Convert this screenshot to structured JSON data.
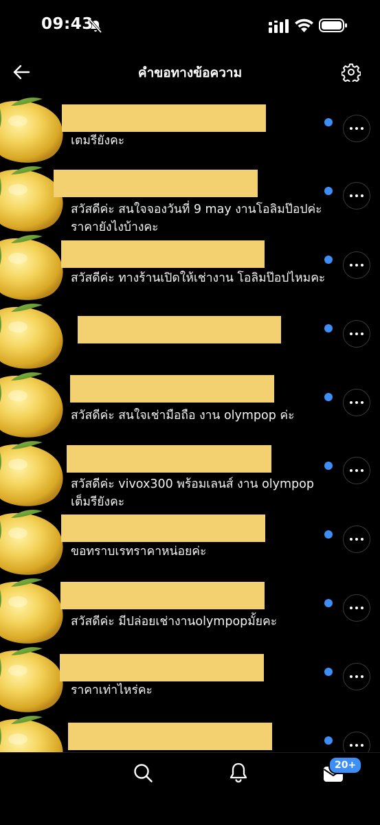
{
  "status_bar": {
    "time": "09:43"
  },
  "header": {
    "title": "คำขอทางข้อความ"
  },
  "requests": [
    {
      "message": "เตมรียังคะ"
    },
    {
      "message": "สวัสดีค่ะ สนใจจองวันที่ 9 may งานโอลิมป๊อปค่ะ ราคายังไงบ้างคะ"
    },
    {
      "message": "สวัสดีค่ะ ทางร้านเปิดให้เช่างาน โอลิมป๊อปไหมคะ"
    },
    {
      "message": ""
    },
    {
      "message": "สวัสดีค่ะ สนใจเช่ามือถือ งาน olympop ค่ะ"
    },
    {
      "message": "สวัสดีค่ะ vivox300 พร้อมเลนส์ งาน olympop เต็มรียังคะ"
    },
    {
      "message": "ขอทราบเรทราคาหน่อยค่ะ"
    },
    {
      "message": "สวัสดีค่ะ มีปล่อยเช่างานolympopมั้ยคะ"
    },
    {
      "message": "ราคาเท่าไหร่คะ"
    },
    {
      "message": ""
    }
  ],
  "bottom_nav": {
    "badge": "20+"
  },
  "colors": {
    "background": "#000000",
    "unread_dot": "#3d8ef7",
    "redaction": "#f3d170"
  }
}
